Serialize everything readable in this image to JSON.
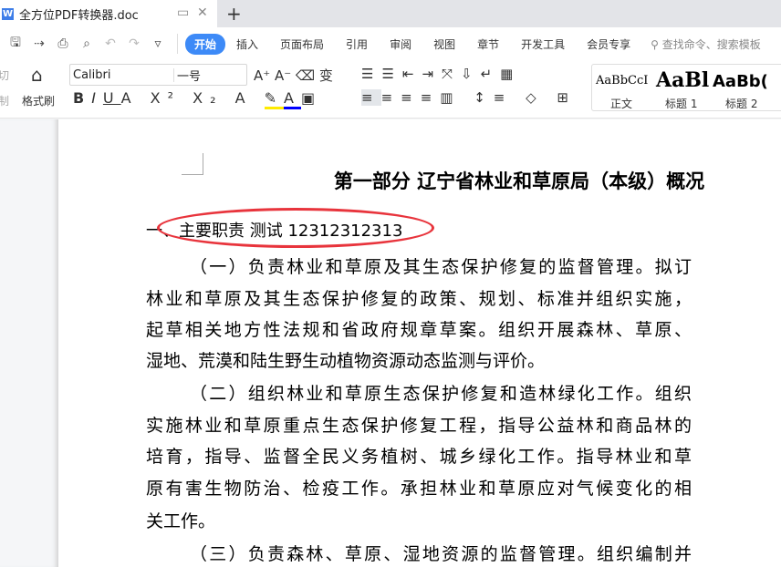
{
  "window": {
    "doc_title": "全方位PDF转换器.doc",
    "new_tab": "+",
    "restore_icon": "▭",
    "close_icon": "✕"
  },
  "menubar": {
    "quick": [
      "save-icon",
      "export-icon",
      "print-icon",
      "preview-icon",
      "undo-icon",
      "redo-icon",
      "more-icon"
    ],
    "items": [
      "开始",
      "插入",
      "页面布局",
      "引用",
      "审阅",
      "视图",
      "章节",
      "开发工具",
      "会员专享"
    ],
    "search_placeholder": "查找命令、搜索模板"
  },
  "ribbon": {
    "cut": "剪切",
    "copy": "复制",
    "format_painter": "格式刷",
    "font_name": "Calibri",
    "font_size": "一号",
    "styles": [
      {
        "preview": "AaBbCcI",
        "label": "正文"
      },
      {
        "preview": "AaBl",
        "label": "标题 1"
      },
      {
        "preview": "AaBb(",
        "label": "标题 2"
      }
    ]
  },
  "document": {
    "title": "第一部分  辽宁省林业和草原局（本级）概况",
    "heading": "一、主要职责 测试 12312312313",
    "annotation_color": "#e8343c",
    "lines": [
      "（一）负责林业和草原及其生态保护修复的监督管理。拟订",
      "林业和草原及其生态保护修复的政策、规划、标准并组织实施，",
      "起草相关地方性法规和省政府规章草案。组织开展森林、草原、",
      "湿地、荒漠和陆生野生动植物资源动态监测与评价。",
      "（二）组织林业和草原生态保护修复和造林绿化工作。组织",
      "实施林业和草原重点生态保护修复工程，指导公益林和商品林的",
      "培育，指导、监督全民义务植树、城乡绿化工作。指导林业和草",
      "原有害生物防治、检疫工作。承担林业和草原应对气候变化的相",
      "关工作。",
      "（三）负责森林、草原、湿地资源的监督管理。组织编制并"
    ]
  }
}
